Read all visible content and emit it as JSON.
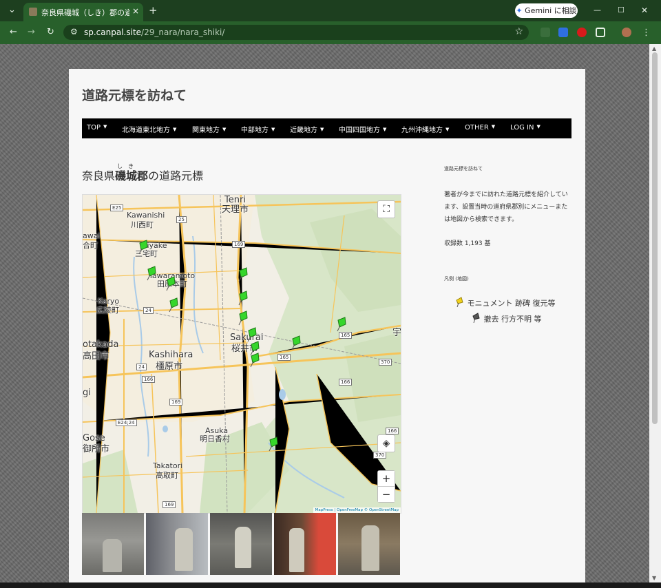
{
  "browser": {
    "tab_title": "奈良県磯城（しき）郡の道路元標",
    "tab_close": "×",
    "new_tab": "+",
    "tab_menu": "⌄",
    "gemini_label": "Gemini に相談",
    "window_controls": {
      "minimize": "—",
      "maximize": "☐",
      "close": "✕"
    },
    "url_domain": "sp.canpal.site",
    "url_path": "/29_nara/nara_shiki/"
  },
  "site": {
    "title": "道路元標を訪ねて",
    "nav": [
      {
        "label": "TOP"
      },
      {
        "label": "北海道東北地方"
      },
      {
        "label": "関東地方"
      },
      {
        "label": "中部地方"
      },
      {
        "label": "近畿地方"
      },
      {
        "label": "中国四国地方"
      },
      {
        "label": "九州沖縄地方"
      },
      {
        "label": "OTHER"
      },
      {
        "label": "LOG IN"
      }
    ]
  },
  "post": {
    "title_prefix": "奈良県",
    "title_bold": "磯城郡",
    "title_ruby": "しき",
    "title_suffix": "の道路元標"
  },
  "map": {
    "labels": {
      "tenri_en": "Tenri",
      "tenri_ja": "天理市",
      "kawanishi_en": "Kawanishi",
      "kawanishi_ja": "川西町",
      "miyake_en": "Miyake",
      "miyake_ja": "三宅町",
      "tawaramoto_en": "Tawaramoto",
      "tawaramoto_ja": "田原本町",
      "koryo_en": "Koryo",
      "koryo_ja": "広陵町",
      "sakurai_en": "Sakurai",
      "sakurai_ja": "桜井市",
      "takada_en": "otakada",
      "takada_ja": "高田市",
      "kashihara_en": "Kashihara",
      "kashihara_ja": "橿原市",
      "gose_en": "Gose",
      "gose_ja": "御所市",
      "asuka_en": "Asuka",
      "asuka_ja": "明日香村",
      "takatori_en": "Takatori",
      "takatori_ja": "高取町",
      "wai_en": "awai",
      "wai_ja": "合町",
      "gi": "gi",
      "edge_char": "宇"
    },
    "shields": {
      "e25": "E25",
      "r25": "25",
      "r169a": "169",
      "r24": "24",
      "r165a": "165",
      "r165b": "165",
      "r370a": "370",
      "r166a": "166",
      "r166b": "166",
      "r169b": "169",
      "e24": "E24;24",
      "r166c": "166",
      "r370b": "370",
      "r169c": "169"
    },
    "controls": {
      "fullscreen": "⛶",
      "locate": "◈",
      "zoom_in": "+",
      "zoom_out": "−"
    },
    "attribution": "MapPress | OpenFreeMap © OpenStreetMap"
  },
  "sidebar": {
    "heading": "道路元標を訪ねて",
    "description": "著者が今までに訪れた道路元標を紹介しています、設置当時の道府県郡別にメニューまたは地図から検索できます。",
    "count": "収録数 1,193 基",
    "legend_title": "凡例 (地図)",
    "legend_monument": "モニュメント 跡碑 復元等",
    "legend_removed": "撤去 行方不明 等"
  },
  "colors": {
    "tab_strip": "#1d3f1f",
    "toolbar": "#28602b",
    "nav_bar": "#000000",
    "pin_green": "#36d62b",
    "pin_yellow": "#f2d21b",
    "pin_gray": "#555555"
  }
}
